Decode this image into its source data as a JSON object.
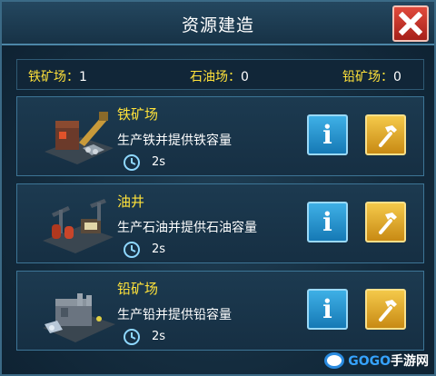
{
  "header": {
    "title": "资源建造"
  },
  "summary": {
    "iron_label": "铁矿场：",
    "iron_count": "1",
    "oil_label": "石油场：",
    "oil_count": "0",
    "lead_label": "铅矿场：",
    "lead_count": "0"
  },
  "buildings": [
    {
      "name": "铁矿场",
      "description": "生产铁并提供铁容量",
      "time": "2s",
      "icon": "iron-mine-icon"
    },
    {
      "name": "油井",
      "description": "生产石油并提供石油容量",
      "time": "2s",
      "icon": "oil-well-icon"
    },
    {
      "name": "铅矿场",
      "description": "生产铅并提供铅容量",
      "time": "2s",
      "icon": "lead-mine-icon"
    }
  ],
  "buttons": {
    "info_glyph": "i"
  },
  "watermark": {
    "brand_a": "GOGO",
    "brand_b": "手游网"
  },
  "colors": {
    "accent_yellow": "#ffe23a",
    "info_blue": "#1e8fd0",
    "build_gold": "#e0a82a",
    "close_red": "#c8322a"
  }
}
